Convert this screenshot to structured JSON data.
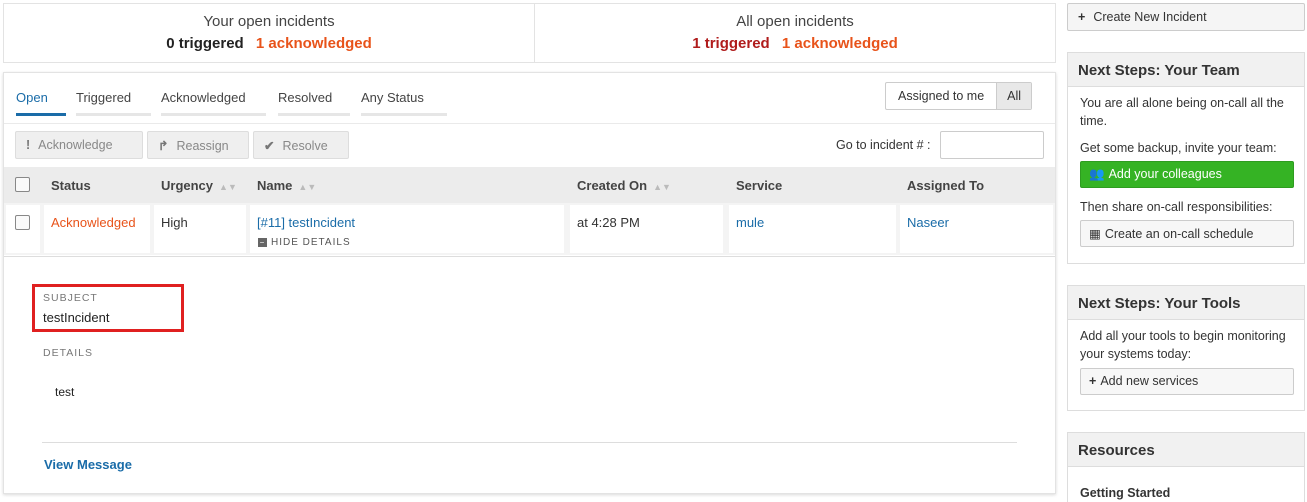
{
  "summary": {
    "yours": {
      "title": "Your open incidents",
      "triggered": "0 triggered",
      "acknowledged": "1 acknowledged"
    },
    "all": {
      "title": "All open incidents",
      "triggered": "1 triggered",
      "acknowledged": "1 acknowledged"
    }
  },
  "tabs": [
    "Open",
    "Triggered",
    "Acknowledged",
    "Resolved",
    "Any Status"
  ],
  "assign_filter": {
    "mine": "Assigned to me",
    "all": "All"
  },
  "actions": {
    "acknowledge": "Acknowledge",
    "reassign": "Reassign",
    "resolve": "Resolve"
  },
  "goto": {
    "label": "Go to incident # :",
    "placeholder": ""
  },
  "table": {
    "headers": {
      "status": "Status",
      "urgency": "Urgency",
      "name": "Name",
      "created": "Created On",
      "service": "Service",
      "assigned": "Assigned To"
    },
    "rows": [
      {
        "status": "Acknowledged",
        "urgency": "High",
        "name": "[#11] testIncident",
        "toggle": "HIDE DETAILS",
        "created": "at 4:28 PM",
        "service": "mule",
        "assigned": "Naseer"
      }
    ]
  },
  "details": {
    "subject_label": "SUBJECT",
    "subject": "testIncident",
    "details_label": "DETAILS",
    "details": "test",
    "view_message": "View Message"
  },
  "sidebar": {
    "create_button": "Create New Incident",
    "team": {
      "title": "Next Steps: Your Team",
      "alone": "You are all alone being on-call all the time.",
      "backup": "Get some backup, invite your team:",
      "add_colleagues": "Add your colleagues",
      "share": "Then share on-call responsibilities:",
      "create_schedule": "Create an on-call schedule"
    },
    "tools": {
      "title": "Next Steps: Your Tools",
      "text": "Add all your tools to begin monitoring your systems today:",
      "add_services": "Add new services"
    },
    "resources": {
      "title": "Resources",
      "getting_started": "Getting Started"
    }
  },
  "colors": {
    "accent": "#1a6ca8",
    "acknowledged": "#e8531a",
    "triggered": "#b01c1c",
    "highlight": "#e02020",
    "green": "#35b324"
  }
}
